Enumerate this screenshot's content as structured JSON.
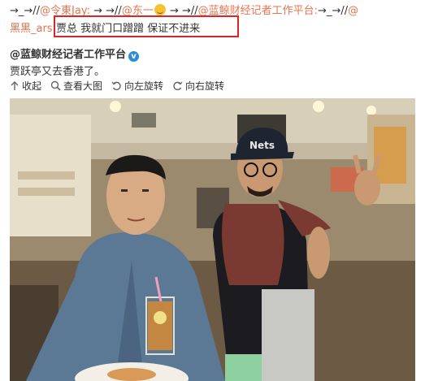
{
  "repost": {
    "line1": [
      {
        "kind": "arrow",
        "text": "→_→//"
      },
      {
        "kind": "mention",
        "text": "@令東Jay"
      },
      {
        "kind": "mention",
        "text": ":"
      },
      {
        "kind": "arrow",
        "text": " → →//"
      },
      {
        "kind": "mention",
        "text": "@东一"
      },
      {
        "kind": "emoji",
        "icon": "grin-emoji-icon"
      },
      {
        "kind": "arrow",
        "text": " → →//"
      },
      {
        "kind": "mention",
        "text": "@蓝鲸财经记者工作平台"
      },
      {
        "kind": "mention",
        "text": ":"
      },
      {
        "kind": "arrow",
        "text": "→_→//"
      },
      {
        "kind": "mention",
        "text": "@"
      }
    ],
    "line2_mention": "黑黑_ars",
    "line2_quote": ":贾总 我就门口蹭蹭 保证不进来"
  },
  "post": {
    "author": "@蓝鲸财经记者工作平台",
    "verified_icon": "v",
    "text": "贾跃亭又去香港了。"
  },
  "toolbar": {
    "collapse": "收起",
    "view_large": "查看大图",
    "rotate_left": "向左旋转",
    "rotate_right": "向右旋转"
  },
  "photo": {
    "cap_text": "Nets"
  },
  "colors": {
    "mention": "#eb7350",
    "highlight_border": "#e02424",
    "verified": "#2d8cd8"
  }
}
